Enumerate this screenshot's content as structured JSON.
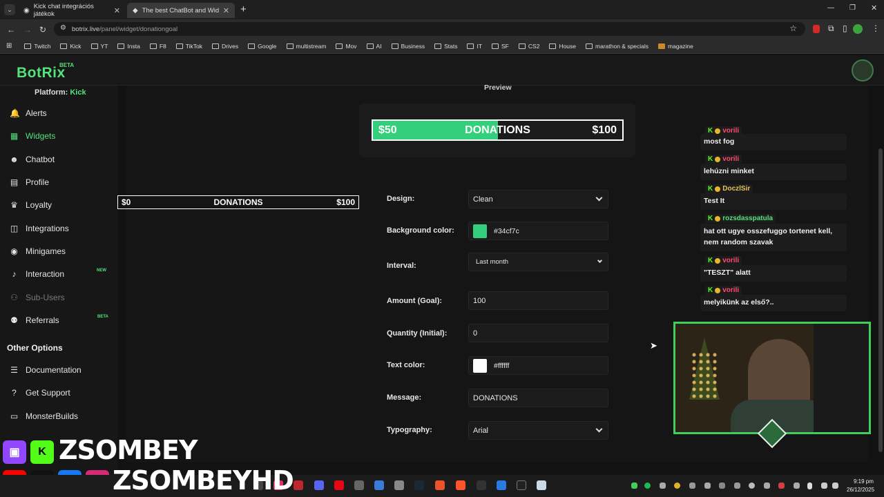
{
  "browser": {
    "tabs": [
      {
        "title": "Kick chat integrációs játékok",
        "active": false
      },
      {
        "title": "The best ChatBot and Widgets",
        "active": true
      }
    ],
    "new_tab_label": "+",
    "url_host": "botrix.live",
    "url_path": "/panel/widget/donationgoal",
    "bookmarks": [
      "Twitch",
      "Kick",
      "YT",
      "Insta",
      "F8",
      "TikTok",
      "Drives",
      "Google",
      "multistream",
      "Mov",
      "AI",
      "Business",
      "Stats",
      "IT",
      "SF",
      "CS2",
      "House",
      "marathon & specials",
      "magazine"
    ]
  },
  "app": {
    "logo": "BotRix",
    "logo_badge": "BETA",
    "platform_label": "Platform:",
    "platform_value": "Kick",
    "nav": [
      {
        "label": "Alerts",
        "icon": "bell-icon"
      },
      {
        "label": "Widgets",
        "icon": "grid-icon",
        "active": true
      },
      {
        "label": "Chatbot",
        "icon": "robot-icon"
      },
      {
        "label": "Profile",
        "icon": "id-card-icon"
      },
      {
        "label": "Loyalty",
        "icon": "trophy-icon"
      },
      {
        "label": "Integrations",
        "icon": "window-icon"
      },
      {
        "label": "Minigames",
        "icon": "gamepad-icon"
      },
      {
        "label": "Interaction",
        "icon": "music-icon",
        "badge": "NEW"
      },
      {
        "label": "Sub-Users",
        "icon": "users-icon",
        "disabled": true
      },
      {
        "label": "Referrals",
        "icon": "people-icon",
        "badge": "BETA"
      }
    ],
    "other_options_title": "Other Options",
    "other_nav": [
      {
        "label": "Documentation",
        "icon": "list-icon"
      },
      {
        "label": "Get Support",
        "icon": "question-icon"
      },
      {
        "label": "MonsterBuilds",
        "icon": "laptop-icon"
      }
    ]
  },
  "preview": {
    "label": "Preview",
    "current": "$50",
    "message": "DONATIONS",
    "goal": "$100",
    "progress_fraction": 0.5
  },
  "preview_small": {
    "current": "$0",
    "message": "DONATIONS",
    "goal": "$100"
  },
  "form": {
    "design": {
      "label": "Design:",
      "value": "Clean"
    },
    "background_color": {
      "label": "Background color:",
      "value": "#34cf7c"
    },
    "interval": {
      "label": "Interval:",
      "value": "Last month"
    },
    "amount_goal": {
      "label": "Amount (Goal):",
      "value": "100"
    },
    "quantity_initial": {
      "label": "Quantity (Initial):",
      "value": "0"
    },
    "text_color": {
      "label": "Text color:",
      "value": "#ffffff"
    },
    "message": {
      "label": "Message:",
      "value": "DONATIONS"
    },
    "typography": {
      "label": "Typography:",
      "value": "Arial"
    }
  },
  "chat": [
    {
      "user": "vorili",
      "user_color": "#ff4b6e",
      "text": "most fog"
    },
    {
      "user": "vorili",
      "user_color": "#ff4b6e",
      "text": "lehúzni minket"
    },
    {
      "user": "DoczlSir",
      "user_color": "#e8c25a",
      "text": "Test It"
    },
    {
      "user": "rozsdasspatula",
      "user_color": "#53e27c",
      "text": "hat ott ugye osszefuggo tortenet kell, nem random szavak"
    },
    {
      "user": "vorili",
      "user_color": "#ff4b6e",
      "text": "\"TESZT\" alatt"
    },
    {
      "user": "vorili",
      "user_color": "#ff4b6e",
      "text": "melyikünk az első?.."
    }
  ],
  "overlay": {
    "name_line1": "ZSOMBEY",
    "name_line2": "ZSOMBEYHD"
  },
  "taskbar": {
    "time": "9:19 pm",
    "date": "26/12/2025"
  }
}
